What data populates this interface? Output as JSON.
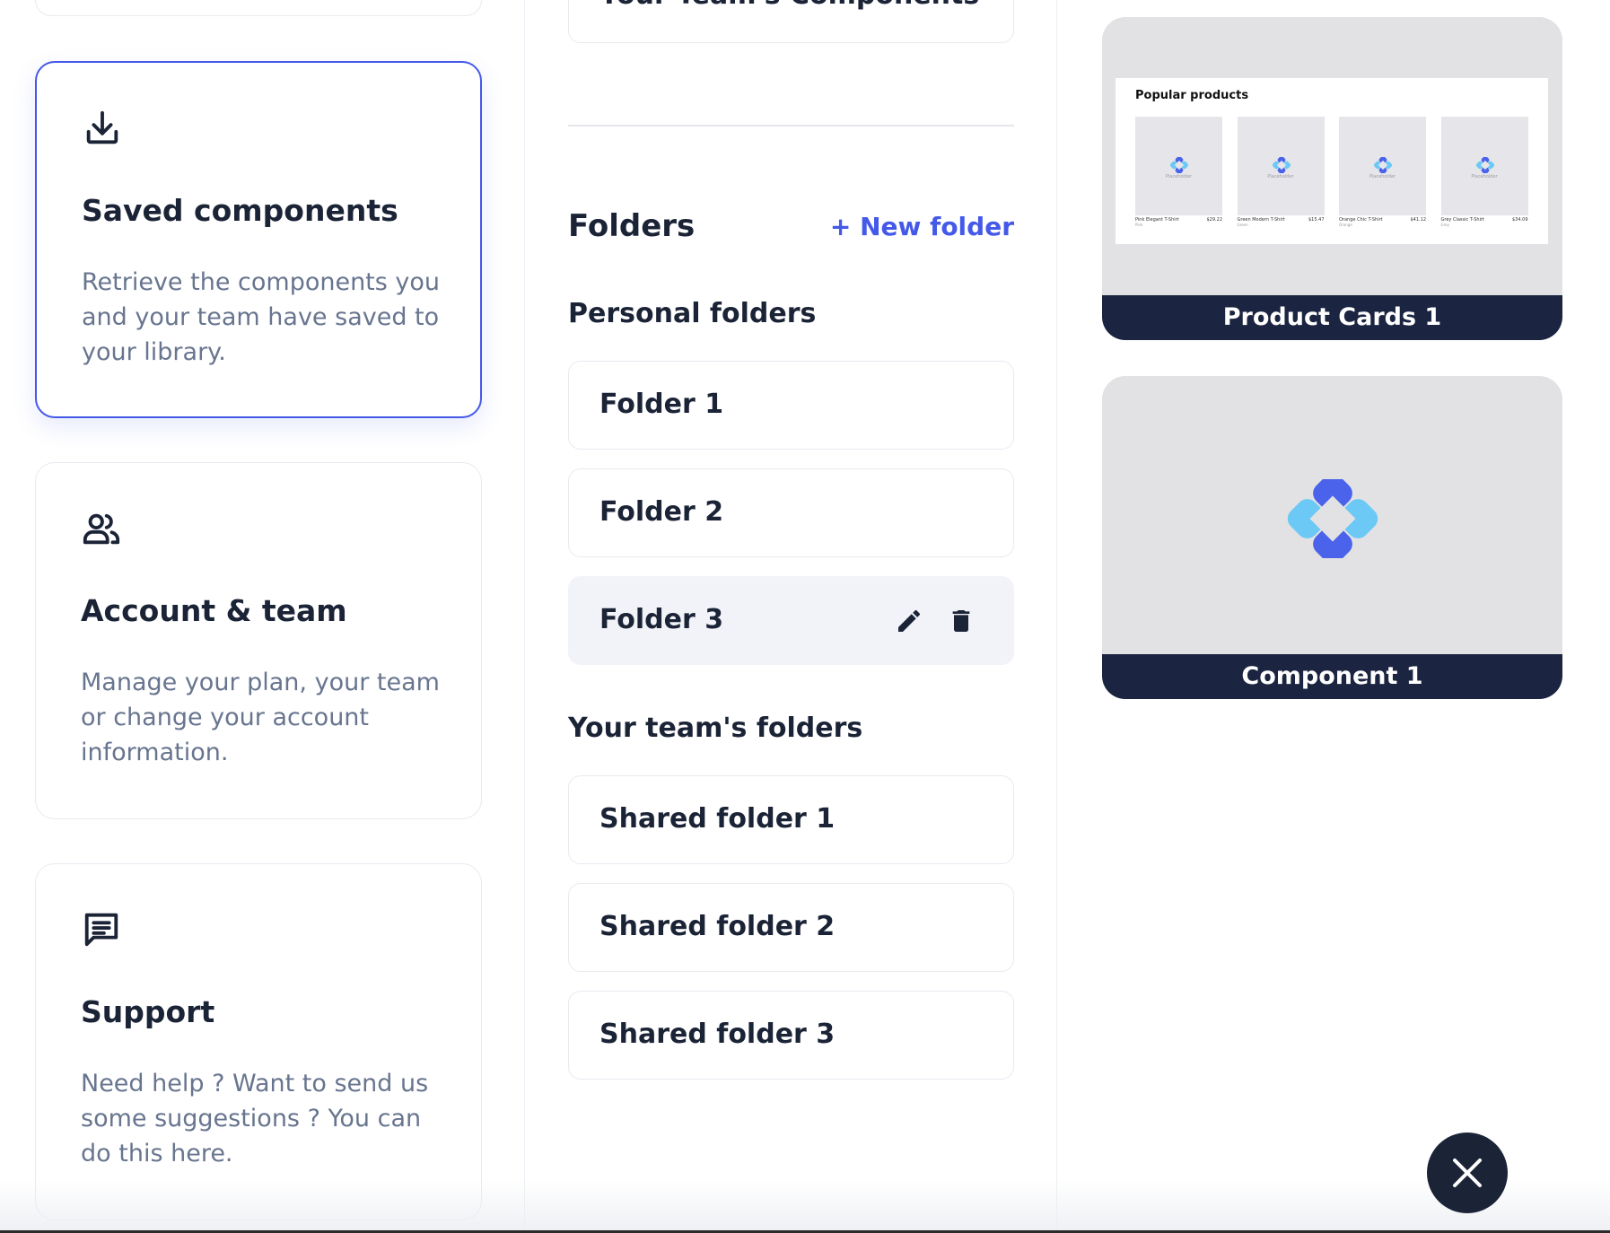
{
  "menu": {
    "cards": [
      {
        "icon": "download-icon",
        "title": "Saved components",
        "description": "Retrieve the components you and your team have saved to your library.",
        "active": true
      },
      {
        "icon": "users-icon",
        "title": "Account & team",
        "description": "Manage your plan, your team or change your account information.",
        "active": false
      },
      {
        "icon": "chat-icon",
        "title": "Support",
        "description": "Need help ? Want to send us some suggestions ? You can do this here.",
        "active": false
      }
    ]
  },
  "library": {
    "team_components_label": "Your Team's Components",
    "folders_title": "Folders",
    "new_folder_label": "+ New folder",
    "personal_label": "Personal folders",
    "personal_folders": [
      "Folder 1",
      "Folder 2",
      "Folder 3"
    ],
    "team_label": "Your team's folders",
    "team_folders": [
      "Shared folder 1",
      "Shared folder 2",
      "Shared folder 3"
    ],
    "hovered_folder": "Folder 3"
  },
  "components": [
    {
      "name": "Product Cards 1",
      "preview": {
        "title": "Popular products",
        "placeholder_label": "Placeholder",
        "items": [
          {
            "name": "Pink Elegant T-Shirt",
            "price": "$29.22",
            "color": "Pink"
          },
          {
            "name": "Green Modern T-Shirt",
            "price": "$15.47",
            "color": "Green"
          },
          {
            "name": "Orange Chic T-Shirt",
            "price": "$41.12",
            "color": "Orange"
          },
          {
            "name": "Grey Classic T-Shirt",
            "price": "$34.09",
            "color": "Grey"
          }
        ]
      }
    },
    {
      "name": "Component 1"
    }
  ],
  "close_button_icon": "close-icon",
  "colors": {
    "accent": "#4459e8",
    "dark": "#1b2336",
    "label_bar": "#1b2440",
    "muted_text": "#68758f",
    "logo_blue": "#4a63ea",
    "logo_light": "#6cc8f5"
  }
}
